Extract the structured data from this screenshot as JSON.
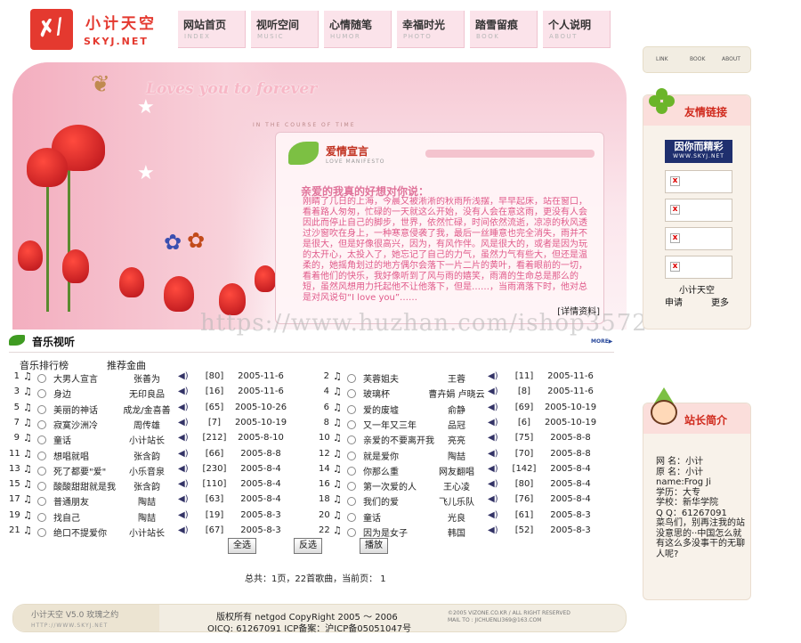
{
  "header": {
    "logo_cn": "小计天空",
    "logo_en": "SKYJ.NET",
    "nav": [
      {
        "cn": "网站首页",
        "en": "INDEX"
      },
      {
        "cn": "视听空间",
        "en": "MUSIC"
      },
      {
        "cn": "心情随笔",
        "en": "HUMOR"
      },
      {
        "cn": "幸福时光",
        "en": "PHOTO"
      },
      {
        "cn": "踏雪留痕",
        "en": "BOOK"
      },
      {
        "cn": "个人说明",
        "en": "ABOUT"
      }
    ],
    "mini_nav": [
      "LINK",
      "BOOK",
      "ABOUT"
    ]
  },
  "hero": {
    "slogan": "Loves you to forever",
    "slogan_sub": "IN THE COURSE OF TIME",
    "panel_title": "爱情宣言",
    "panel_sub": "LOVE MANIFESTO",
    "heading": "亲爱的我真的好想对你说：",
    "text": "刚睛了几日的上海，今晨又被淅淅的秋雨所浅摆，早早起床，站在窗口，看着路人匆匆，忙碌的一天就这么开始，没有人会在意这雨，更没有人会因此而停止自己的脚步，世界，依然忙碌，时间依然流逝，凉凉的秋风透过沙窗吹在身上，一种寒意侵袭了我，最后一丝睡意也完全消失，雨并不是很大，但是好像很高兴，因为，有风作伴。风是很大的，或者是因为玩的太开心，太投入了，她忘记了自己的力气，虽然力气有些大，但还是温柔的，她摇角划过的地方偶尔会落下一片二片的黄叶，看着眼前的一切，看着他们的快乐，我好像听到了风与雨的嬉笑，雨滴的生命总是那么的短，虽然风想用力托起他不让他落下，但是……，当雨滴落下时，他对总是对风说句“I love you”……",
    "detail": "[详情资料]",
    "watermark": "https://www.huzhan.com/ishop3572"
  },
  "music": {
    "title": "音乐视听",
    "more": "MORE▶",
    "col_rank": "音乐排行榜",
    "col_recommend": "推荐金曲",
    "songs": [
      {
        "n": "1",
        "title": "大男人宣言",
        "singer": "张善为",
        "hits": "[80]",
        "date": "2005-11-6"
      },
      {
        "n": "2",
        "title": "芙蓉姐夫",
        "singer": "王蓉",
        "hits": "[11]",
        "date": "2005-11-6"
      },
      {
        "n": "3",
        "title": "身边",
        "singer": "无印良品",
        "hits": "[16]",
        "date": "2005-11-6"
      },
      {
        "n": "4",
        "title": "玻璃杯",
        "singer": "曹卉娟 卢晓云",
        "hits": "[8]",
        "date": "2005-11-6"
      },
      {
        "n": "5",
        "title": "美丽的神话",
        "singer": "成龙/金喜善",
        "hits": "[65]",
        "date": "2005-10-26"
      },
      {
        "n": "6",
        "title": "爱的废墟",
        "singer": "俞静",
        "hits": "[69]",
        "date": "2005-10-19"
      },
      {
        "n": "7",
        "title": "寂寞沙洲冷",
        "singer": "周传雄",
        "hits": "[7]",
        "date": "2005-10-19"
      },
      {
        "n": "8",
        "title": "又一年又三年",
        "singer": "品冠",
        "hits": "[6]",
        "date": "2005-10-19"
      },
      {
        "n": "9",
        "title": "童话",
        "singer": "小计站长",
        "hits": "[212]",
        "date": "2005-8-10"
      },
      {
        "n": "10",
        "title": "亲爱的不要离开我",
        "singer": "亮亮",
        "hits": "[75]",
        "date": "2005-8-8"
      },
      {
        "n": "11",
        "title": "想唱就唱",
        "singer": "张含韵",
        "hits": "[66]",
        "date": "2005-8-8"
      },
      {
        "n": "12",
        "title": "就是爱你",
        "singer": "陶喆",
        "hits": "[70]",
        "date": "2005-8-8"
      },
      {
        "n": "13",
        "title": "死了都要\"爱\"",
        "singer": "小乐音泉",
        "hits": "[230]",
        "date": "2005-8-4"
      },
      {
        "n": "14",
        "title": "你那么重",
        "singer": "网友翻唱",
        "hits": "[142]",
        "date": "2005-8-4"
      },
      {
        "n": "15",
        "title": "酸酸甜甜就是我",
        "singer": "张含韵",
        "hits": "[110]",
        "date": "2005-8-4"
      },
      {
        "n": "16",
        "title": "第一次爱的人",
        "singer": "王心凌",
        "hits": "[80]",
        "date": "2005-8-4"
      },
      {
        "n": "17",
        "title": "普通朋友",
        "singer": "陶喆",
        "hits": "[63]",
        "date": "2005-8-4"
      },
      {
        "n": "18",
        "title": "我们的爱",
        "singer": "飞儿乐队",
        "hits": "[76]",
        "date": "2005-8-4"
      },
      {
        "n": "19",
        "title": "找自己",
        "singer": "陶喆",
        "hits": "[19]",
        "date": "2005-8-3"
      },
      {
        "n": "20",
        "title": "童话",
        "singer": "光良",
        "hits": "[61]",
        "date": "2005-8-3"
      },
      {
        "n": "21",
        "title": "绝口不提爱你",
        "singer": "小计站长",
        "hits": "[67]",
        "date": "2005-8-3"
      },
      {
        "n": "22",
        "title": "因为是女子",
        "singer": "韩国",
        "hits": "[52]",
        "date": "2005-8-3"
      }
    ],
    "buttons": {
      "select_all": "全选",
      "invert": "反选",
      "play": "播放"
    },
    "total": "总共：1页，22首歌曲，当前页： 1"
  },
  "footer": {
    "brand": "小计天空 V5.0 玫瑰之约",
    "url": "HTTP://WWW.SKYJ.NET",
    "copyright": "版权所有 netgod CopyRight 2005 ～ 2006",
    "icp": "OICQ: 61267091 ICP备案：沪ICP备05051047号",
    "right_line1": "©2005 VIZONE.CO.KR / ALL RIGHT RESERVED",
    "right_line2": "MAIL TO : JICHUENLI369@163.COM"
  },
  "sidebar": {
    "links_title": "友情链接",
    "banner_cn": "因你而精彩",
    "banner_en": "WWW.SKYJ.NET",
    "site_name": "小计天空",
    "apply": "申请",
    "more": "更多",
    "owner_title": "站长简介",
    "owner_info": [
      "网 名：小计",
      "原 名：小计",
      "name:Frog Ji",
      "学历：大专",
      "学校：新华学院",
      "Q Q：61267091",
      "菜鸟们，别再注我的站",
      "没意思的··中国怎么就",
      "有这么多没事干的无聊",
      "人呢?"
    ]
  },
  "colors": {
    "accent": "#e4392f",
    "pink": "#f8cfd9",
    "green": "#6bb52a"
  }
}
